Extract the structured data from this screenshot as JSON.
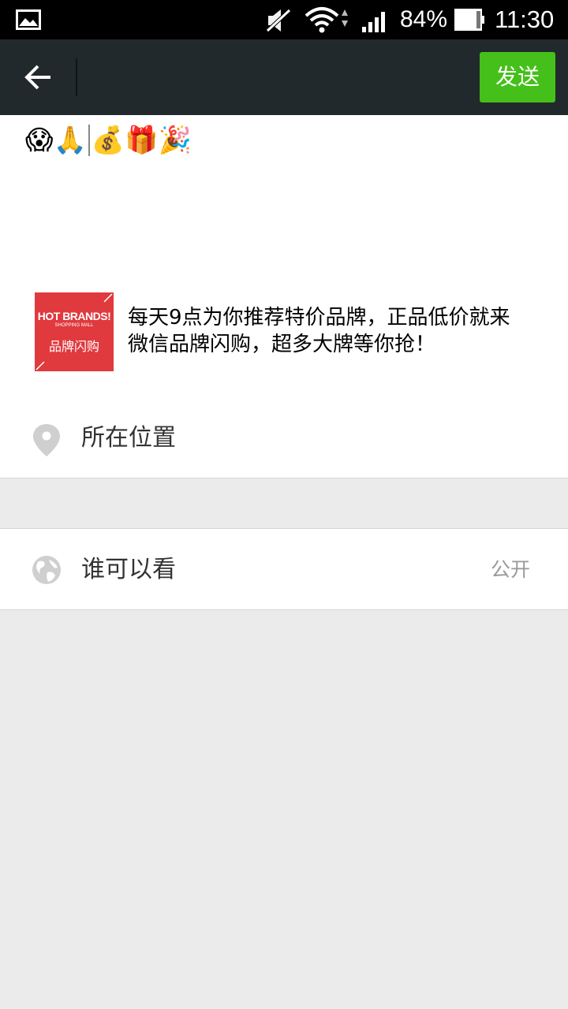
{
  "status_bar": {
    "battery_percent": "84%",
    "time": "11:30",
    "icons": [
      "gallery-icon",
      "mute-icon",
      "wifi-icon",
      "signal-icon",
      "battery-icon"
    ]
  },
  "action_bar": {
    "back_icon": "back-arrow-icon",
    "send_label": "发送",
    "send_color": "#45c01a"
  },
  "post": {
    "text_before_cursor": "😱🙏",
    "text_after_cursor": "💰🎁🎉"
  },
  "share_card": {
    "thumb_title": "HOT BRANDS!",
    "thumb_subtitle": "SHOPPING MALL",
    "thumb_cn": "品牌闪购",
    "description_line1": "每天9点为你推荐特价品牌，正品低价就来",
    "description_line2": "微信品牌闪购，超多大牌等你抢！"
  },
  "location": {
    "icon": "location-pin-icon",
    "label": "所在位置"
  },
  "visibility": {
    "icon": "globe-icon",
    "label": "谁可以看",
    "value": "公开"
  }
}
